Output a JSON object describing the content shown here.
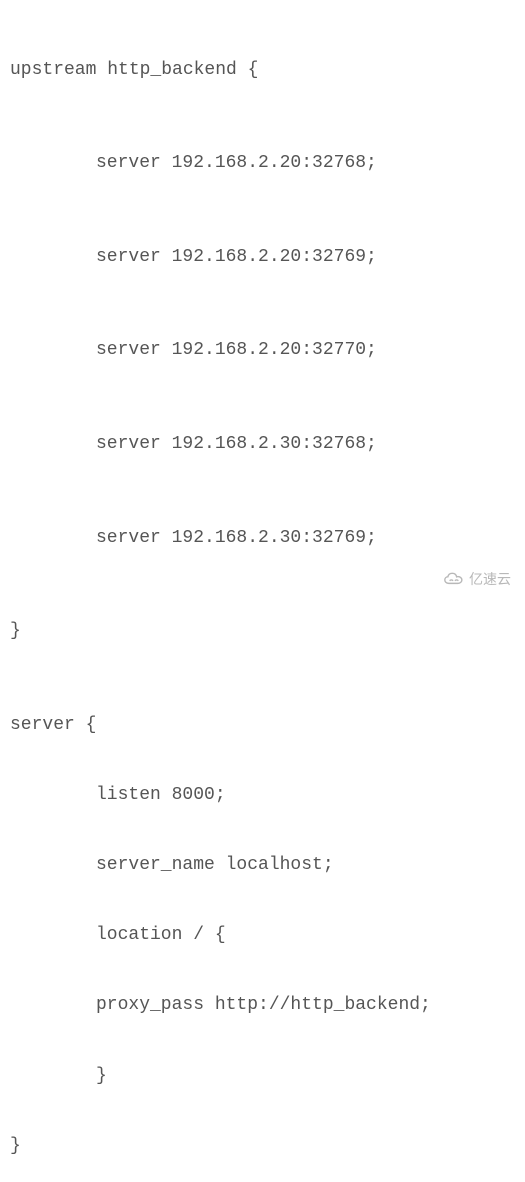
{
  "config": {
    "upstream_open": "upstream http_backend {",
    "servers": [
      "server 192.168.2.20:32768;",
      "server 192.168.2.20:32769;",
      "server 192.168.2.20:32770;",
      "server 192.168.2.30:32768;",
      "server 192.168.2.30:32769;"
    ],
    "upstream_close": "}",
    "server_open": "server {",
    "listen": "listen 8000;",
    "server_name": "server_name localhost;",
    "location": "location / {",
    "proxy_pass": "proxy_pass http://http_backend;",
    "location_close": "}",
    "server_close": "}"
  },
  "watermark": {
    "text": "亿速云"
  }
}
